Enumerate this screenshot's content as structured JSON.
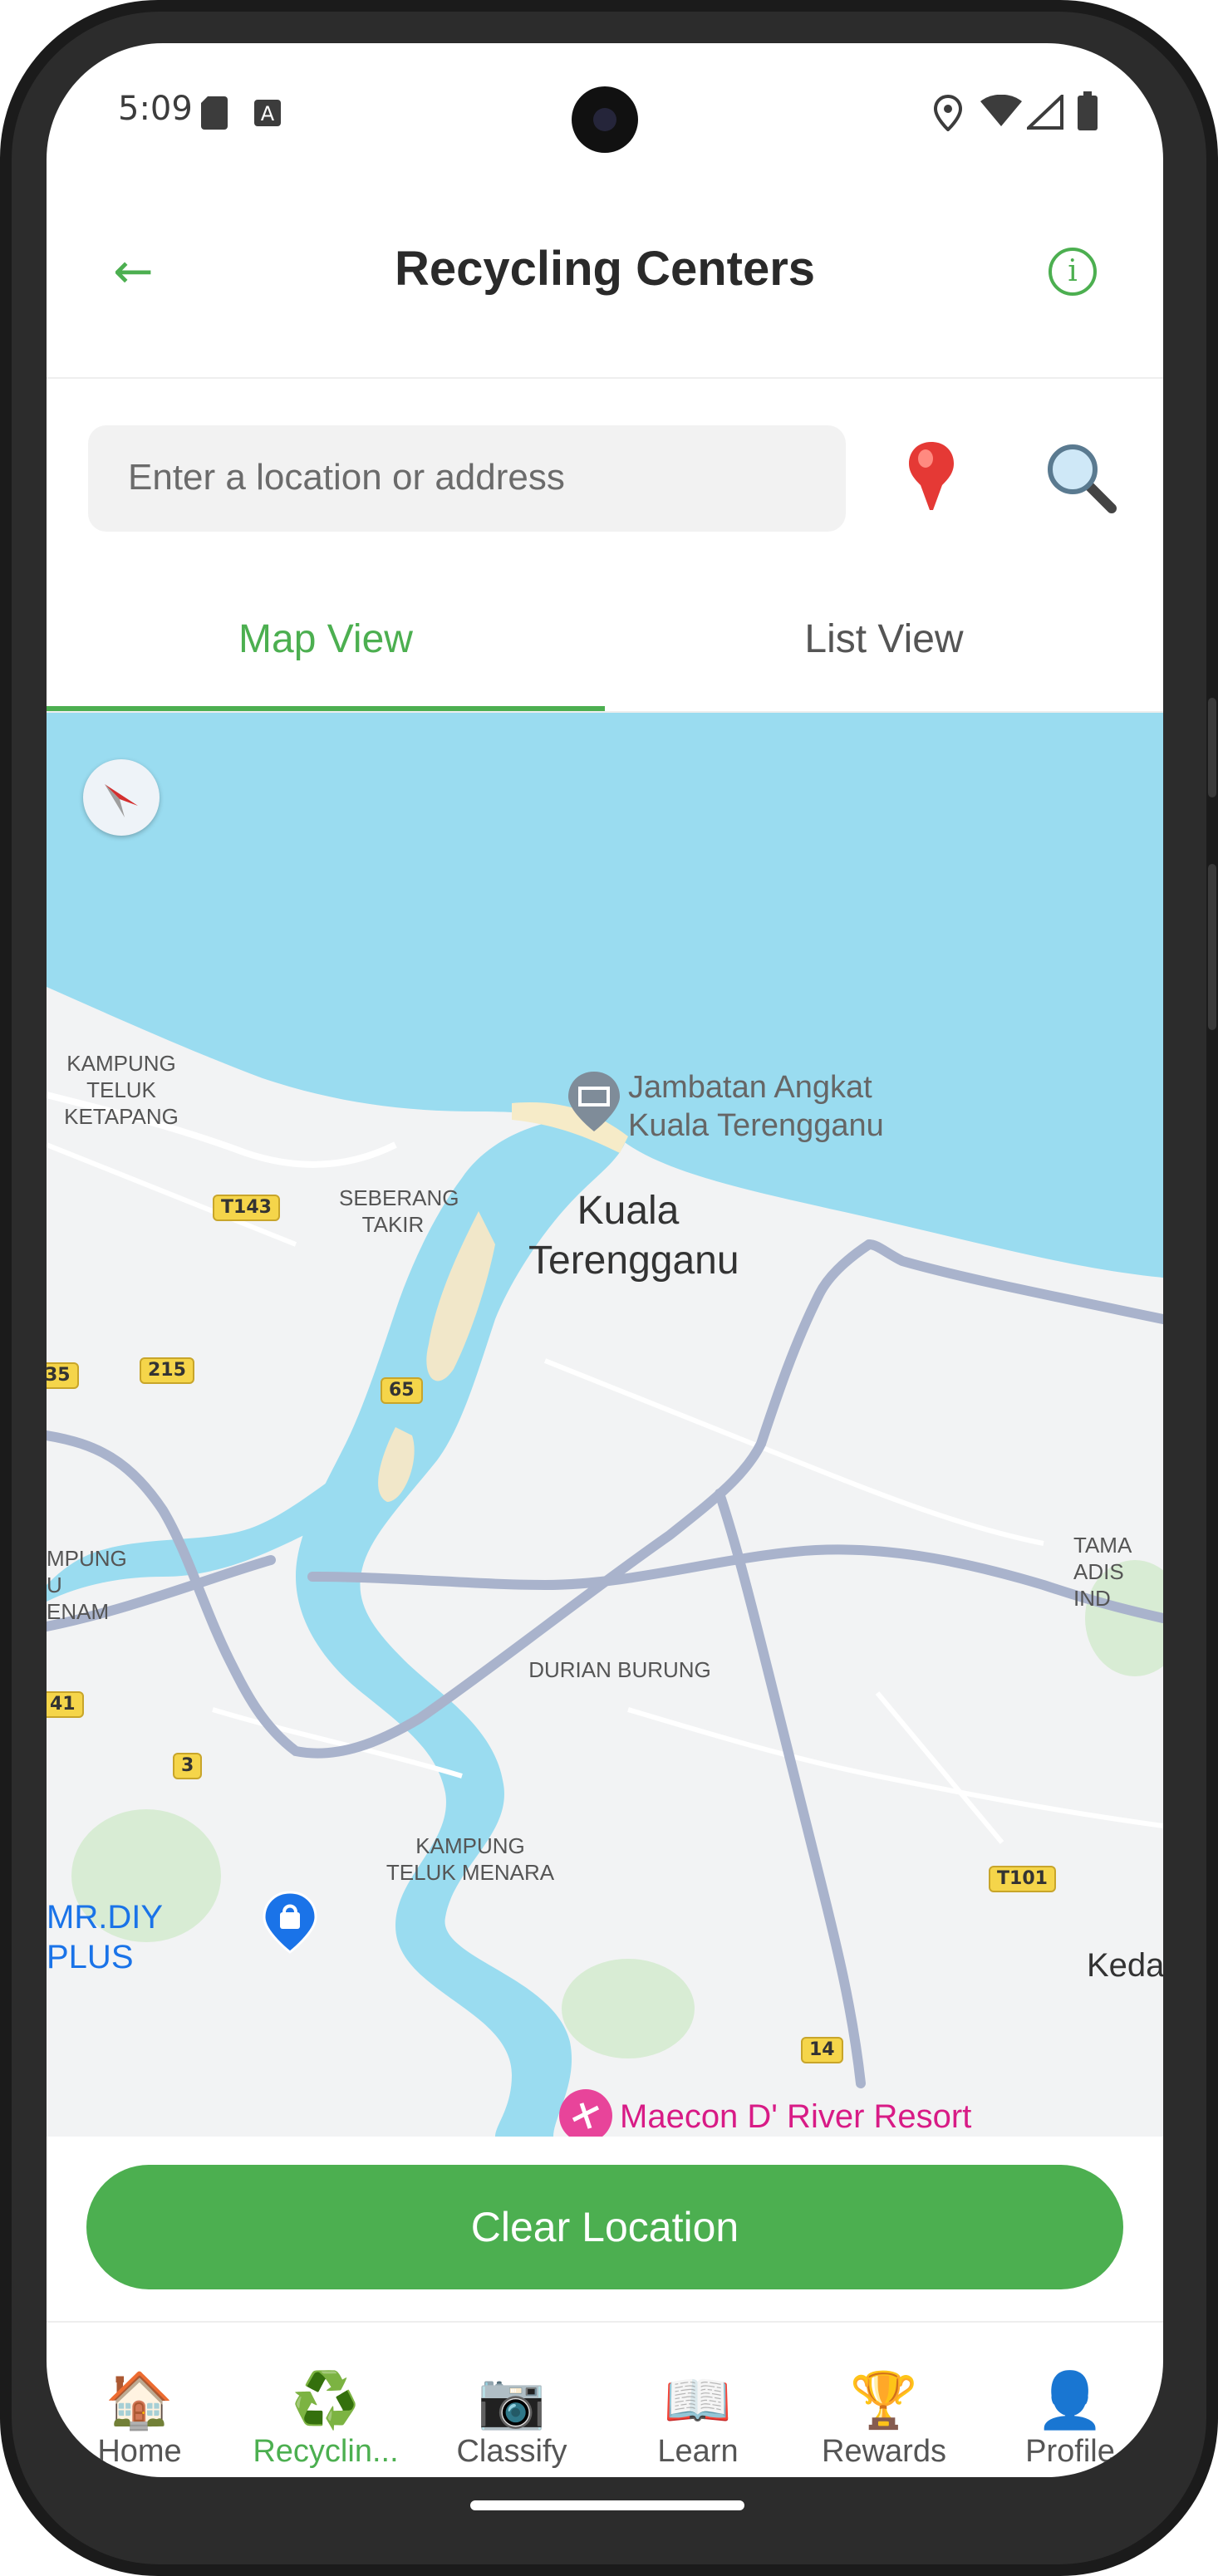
{
  "status_bar": {
    "time": "5:09"
  },
  "header": {
    "title": "Recycling Centers",
    "back_label": "←",
    "info_label": "i"
  },
  "search": {
    "placeholder": "Enter a location or address"
  },
  "tabs": [
    {
      "label": "Map View"
    },
    {
      "label": "List View"
    }
  ],
  "map": {
    "labels": {
      "kampung_teluk_ketapang": "KAMPUNG\nTELUK\nKETAPANG",
      "seberang_takir": "SEBERANG\nTAKIR",
      "kuala_terengganu": "Kuala\nTerengganu",
      "jambatan": "Jambatan Angkat\nKuala Terengganu",
      "durian_burung": "DURIAN BURUNG",
      "kampung_teluk_menara": "KAMPUNG\nTELUK MENARA",
      "mr_diy": "MR.DIY PLUS",
      "maecon": "Maecon D' River Resort",
      "tamar": "TAMA\nADIS IND",
      "kampung_enam": "MPUNG\nU ENAM",
      "keda": "Keda"
    },
    "shields": [
      "T143",
      "215",
      "65",
      "35",
      "41",
      "3",
      "T101",
      "14"
    ]
  },
  "clear_button": {
    "label": "Clear Location"
  },
  "nav": [
    {
      "label": "Home",
      "icon": "🏠",
      "active": false
    },
    {
      "label": "Recyclin...",
      "icon": "♻️",
      "active": true
    },
    {
      "label": "Classify",
      "icon": "📷",
      "active": false
    },
    {
      "label": "Learn",
      "icon": "📖",
      "active": false
    },
    {
      "label": "Rewards",
      "icon": "🏆",
      "active": false
    },
    {
      "label": "Profile",
      "icon": "👤",
      "active": false
    }
  ],
  "colors": {
    "accent": "#4caf50",
    "water": "#9adcf0",
    "road": "#a9b3cc"
  }
}
